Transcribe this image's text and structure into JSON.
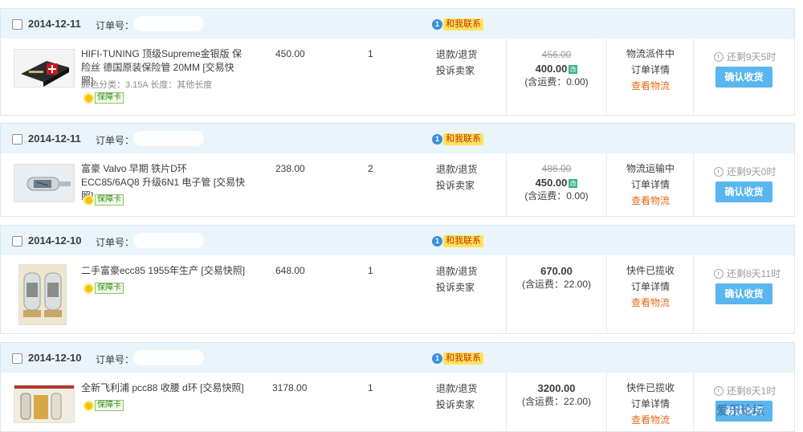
{
  "orders": [
    {
      "date": "2014-12-11",
      "order_label": "订单号：",
      "contact": "和我联系",
      "title": "HIFI-TUNING 顶级Supreme金银版 保险丝 德国原装保险管 20MM [交易快照]",
      "sku": "颜色分类：3.15A 长度：其他长度",
      "badge": "保障卡",
      "price": "450.00",
      "qty": "1",
      "op1": "退款/退货",
      "op2": "投诉卖家",
      "orig_price": "456.00",
      "final_price": "400.00",
      "mod_mark": "改",
      "shipping": "(含运费：0.00)",
      "status": "物流派件中",
      "detail": "订单详情",
      "logistics": "查看物流",
      "remain": "还剩9天5时",
      "confirm": "确认收货"
    },
    {
      "date": "2014-12-11",
      "order_label": "订单号：",
      "contact": "和我联系",
      "title": "富豪 Valvo 早期 铁片D环 ECC85/6AQ8 升级6N1 电子管 [交易快照]",
      "sku": "",
      "badge": "保障卡",
      "price": "238.00",
      "qty": "2",
      "op1": "退款/退货",
      "op2": "投诉卖家",
      "orig_price": "486.00",
      "final_price": "450.00",
      "mod_mark": "改",
      "shipping": "(含运费：0.00)",
      "status": "物流运输中",
      "detail": "订单详情",
      "logistics": "查看物流",
      "remain": "还剩9天0时",
      "confirm": "确认收货"
    },
    {
      "date": "2014-12-10",
      "order_label": "订单号：",
      "contact": "和我联系",
      "title": "二手富豪ecc85 1955年生产 [交易快照]",
      "sku": "",
      "badge": "保障卡",
      "price": "648.00",
      "qty": "1",
      "op1": "退款/退货",
      "op2": "投诉卖家",
      "orig_price": "",
      "final_price": "670.00",
      "mod_mark": "",
      "shipping": "(含运费：22.00)",
      "status": "快件已揽收",
      "detail": "订单详情",
      "logistics": "查看物流",
      "remain": "还剩8天11时",
      "confirm": "确认收货"
    },
    {
      "date": "2014-12-10",
      "order_label": "订单号：",
      "contact": "和我联系",
      "title": "全新飞利浦 pcc88 收腰 d环 [交易快照]",
      "sku": "",
      "badge": "保障卡",
      "price": "3178.00",
      "qty": "1",
      "op1": "退款/退货",
      "op2": "投诉卖家",
      "orig_price": "",
      "final_price": "3200.00",
      "mod_mark": "",
      "shipping": "(含运费：22.00)",
      "status": "快件已揽收",
      "detail": "订单详情",
      "logistics": "查看物流",
      "remain": "还剩8天1时",
      "confirm": "确认收货"
    }
  ],
  "watermark": "爱乐论坛"
}
